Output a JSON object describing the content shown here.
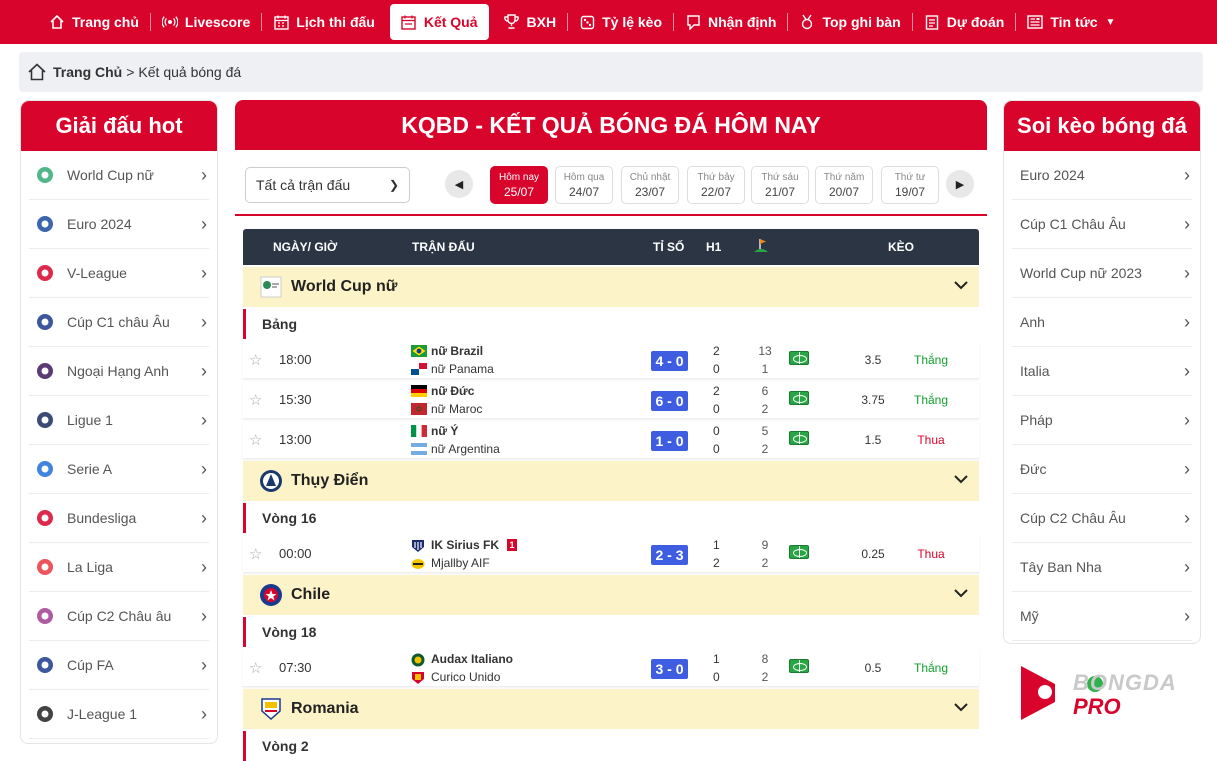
{
  "nav": [
    {
      "label": "Trang chủ",
      "icon": "home-icon"
    },
    {
      "label": "Livescore",
      "icon": "live-icon"
    },
    {
      "label": "Lịch thi đấu",
      "icon": "calendar-icon"
    },
    {
      "label": "Kết Quả",
      "icon": "results-icon",
      "active": true
    },
    {
      "label": "BXH",
      "icon": "trophy-icon"
    },
    {
      "label": "Tỷ lệ kèo",
      "icon": "odds-icon"
    },
    {
      "label": "Nhận định",
      "icon": "analysis-icon"
    },
    {
      "label": "Top ghi bàn",
      "icon": "medal-icon"
    },
    {
      "label": "Dự đoán",
      "icon": "predict-icon"
    },
    {
      "label": "Tin tức",
      "icon": "news-icon"
    }
  ],
  "breadcrumb": {
    "home": "Trang Chủ",
    "sep": ">",
    "current": "Kết quả bóng đá"
  },
  "left": {
    "title": "Giải đấu hot",
    "items": [
      "World Cup nữ",
      "Euro 2024",
      "V-League",
      "Cúp C1 châu Âu",
      "Ngoại Hạng Anh",
      "Ligue 1",
      "Serie A",
      "Bundesliga",
      "La Liga",
      "Cúp C2 Châu âu",
      "Cúp FA",
      "J-League 1"
    ]
  },
  "right": {
    "title": "Soi kèo bóng đá",
    "items": [
      "Euro 2024",
      "Cúp C1 Châu Âu",
      "World Cup nữ 2023",
      "Anh",
      "Italia",
      "Pháp",
      "Đức",
      "Cúp C2 Châu Âu",
      "Tây Ban Nha",
      "Mỹ"
    ]
  },
  "main": {
    "title": "KQBD - KẾT QUẢ BÓNG ĐÁ HÔM NAY",
    "filter": "Tất cả trận đấu",
    "dates": [
      {
        "day": "Hôm nay",
        "date": "25/07",
        "active": true
      },
      {
        "day": "Hôm qua",
        "date": "24/07"
      },
      {
        "day": "Chủ nhật",
        "date": "23/07"
      },
      {
        "day": "Thứ bảy",
        "date": "22/07"
      },
      {
        "day": "Thứ sáu",
        "date": "21/07"
      },
      {
        "day": "Thứ năm",
        "date": "20/07"
      },
      {
        "day": "Thứ tư",
        "date": "19/07"
      }
    ],
    "headers": {
      "time": "NGÀY/ GIỜ",
      "match": "TRẬN ĐẤU",
      "score": "TỈ SỐ",
      "h1": "H1",
      "odds": "KÈO"
    },
    "leagues": [
      {
        "name": "World Cup nữ",
        "round": "Bảng",
        "matches": [
          {
            "time": "18:00",
            "home": "nữ Brazil",
            "away": "nữ Panama",
            "score": "4 - 0",
            "h1h": "2",
            "h1a": "0",
            "ch": "13",
            "ca": "1",
            "odds": "3.5",
            "result": "Thắng",
            "win": true
          },
          {
            "time": "15:30",
            "home": "nữ Đức",
            "away": "nữ Maroc",
            "score": "6 - 0",
            "h1h": "2",
            "h1a": "0",
            "ch": "6",
            "ca": "2",
            "odds": "3.75",
            "result": "Thắng",
            "win": true
          },
          {
            "time": "13:00",
            "home": "nữ Ý",
            "away": "nữ Argentina",
            "score": "1 - 0",
            "h1h": "0",
            "h1a": "0",
            "ch": "5",
            "ca": "2",
            "odds": "1.5",
            "result": "Thua",
            "win": false
          }
        ]
      },
      {
        "name": "Thụy Điển",
        "round": "Vòng 16",
        "matches": [
          {
            "time": "00:00",
            "home": "IK Sirius FK",
            "away": "Mjallby AIF",
            "score": "2 - 3",
            "h1h": "1",
            "h1a": "2",
            "ch": "9",
            "ca": "2",
            "odds": "0.25",
            "result": "Thua",
            "win": false,
            "card": "1"
          }
        ]
      },
      {
        "name": "Chile",
        "round": "Vòng 18",
        "matches": [
          {
            "time": "07:30",
            "home": "Audax Italiano",
            "away": "Curico Unido",
            "score": "3 - 0",
            "h1h": "1",
            "h1a": "0",
            "ch": "8",
            "ca": "2",
            "odds": "0.5",
            "result": "Thắng",
            "win": true
          }
        ]
      },
      {
        "name": "Romania",
        "round": "Vòng 2",
        "matches": []
      }
    ]
  },
  "brand": {
    "line1": "BONGDA",
    "line2": "PRO"
  }
}
